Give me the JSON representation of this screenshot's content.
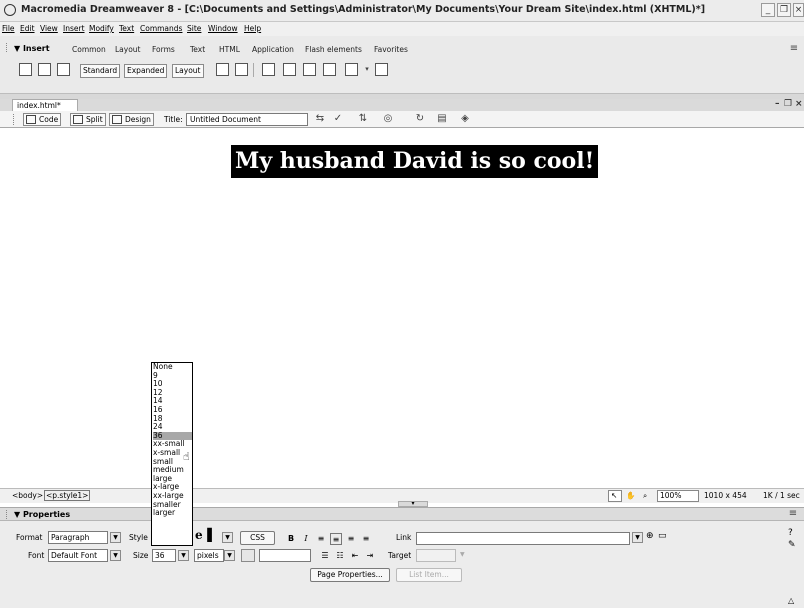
{
  "window": {
    "title": "Macromedia Dreamweaver 8 - [C:\\Documents and Settings\\Administrator\\My Documents\\Your Dream Site\\index.html (XHTML)*]"
  },
  "menubar": {
    "items": [
      "File",
      "Edit",
      "View",
      "Insert",
      "Modify",
      "Text",
      "Commands",
      "Site",
      "Window",
      "Help"
    ]
  },
  "insert_bar": {
    "title": "▼ Insert",
    "tabs": [
      "Common",
      "Layout",
      "Forms",
      "Text",
      "HTML",
      "Application",
      "Flash elements",
      "Favorites"
    ],
    "modes": [
      "Standard",
      "Expanded",
      "Layout"
    ]
  },
  "document": {
    "tab_label": "index.html*",
    "view_buttons": [
      "Code",
      "Split",
      "Design"
    ],
    "title_label": "Title:",
    "title_value": "Untitled Document",
    "headline": "My husband David is so cool!"
  },
  "status": {
    "tags": [
      "<body>",
      "<p.style1>"
    ],
    "zoom": "100%",
    "dimensions": "1010 x 454",
    "file_size": "1K / 1 sec"
  },
  "properties": {
    "header": "▼ Properties",
    "format_label": "Format",
    "format_value": "Paragraph",
    "style_label": "Style",
    "css_button": "CSS",
    "link_label": "Link",
    "font_label": "Font",
    "font_value": "Default Font",
    "size_label": "Size",
    "size_value": "36",
    "size_unit": "pixels",
    "target_label": "Target",
    "page_properties_button": "Page Properties...",
    "list_item_button": "List Item..."
  },
  "size_dropdown": {
    "options": [
      "None",
      "9",
      "10",
      "12",
      "14",
      "16",
      "18",
      "24",
      "36",
      "xx-small",
      "x-small",
      "small",
      "medium",
      "large",
      "x-large",
      "xx-large",
      "smaller",
      "larger"
    ],
    "selected": "36"
  },
  "colors": {
    "headline_bg": "#000000",
    "headline_text": "#ffffff",
    "selection_highlight": "#a8a8a8"
  }
}
